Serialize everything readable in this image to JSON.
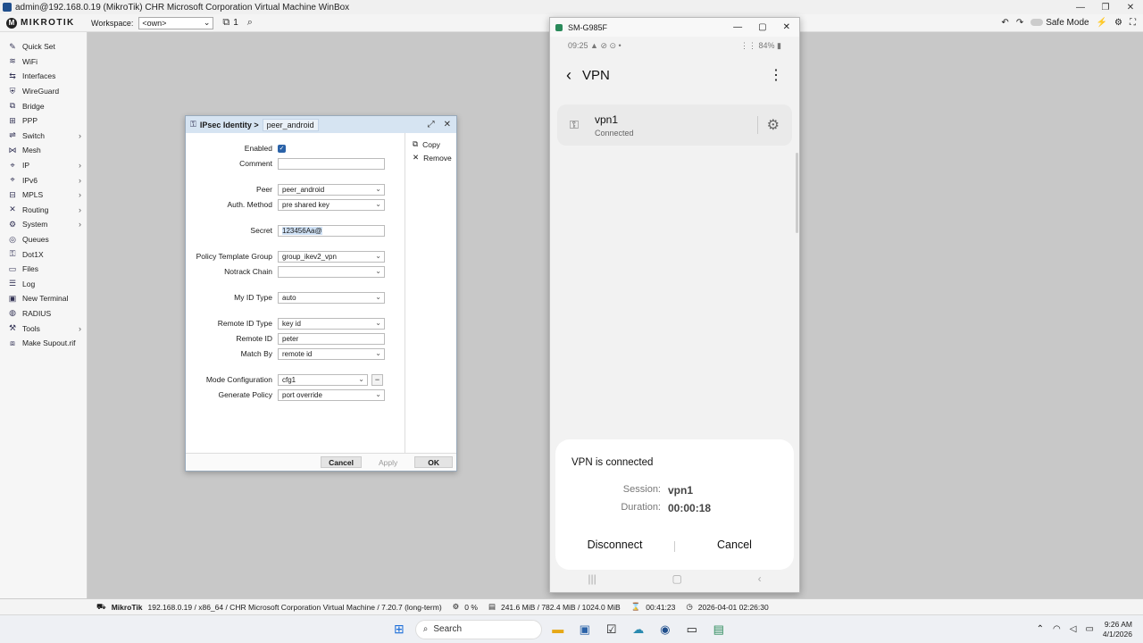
{
  "window": {
    "title": "admin@192.168.0.19 (MikroTik) CHR Microsoft Corporation Virtual Machine WinBox",
    "controls": [
      "—",
      "❐",
      "✕"
    ]
  },
  "toolbar": {
    "logo_text": "MIKROTIK",
    "workspace_label": "Workspace:",
    "workspace_value": "<own>",
    "window_count": "1",
    "safe_mode_label": "Safe Mode"
  },
  "sidebar": {
    "items": [
      {
        "label": "Quick Set",
        "icon": "✎",
        "submenu": false
      },
      {
        "label": "WiFi",
        "icon": "≋",
        "submenu": false
      },
      {
        "label": "Interfaces",
        "icon": "⇆",
        "submenu": false
      },
      {
        "label": "WireGuard",
        "icon": "⛨",
        "submenu": false
      },
      {
        "label": "Bridge",
        "icon": "⧉",
        "submenu": false
      },
      {
        "label": "PPP",
        "icon": "⊞",
        "submenu": false
      },
      {
        "label": "Switch",
        "icon": "⇌",
        "submenu": true
      },
      {
        "label": "Mesh",
        "icon": "⋈",
        "submenu": false
      },
      {
        "label": "IP",
        "icon": "⌖",
        "submenu": true
      },
      {
        "label": "IPv6",
        "icon": "⌖",
        "submenu": true
      },
      {
        "label": "MPLS",
        "icon": "⊟",
        "submenu": true
      },
      {
        "label": "Routing",
        "icon": "✕",
        "submenu": true
      },
      {
        "label": "System",
        "icon": "⚙",
        "submenu": true
      },
      {
        "label": "Queues",
        "icon": "◎",
        "submenu": false
      },
      {
        "label": "Dot1X",
        "icon": "⚿",
        "submenu": false
      },
      {
        "label": "Files",
        "icon": "▭",
        "submenu": false
      },
      {
        "label": "Log",
        "icon": "☰",
        "submenu": false
      },
      {
        "label": "New Terminal",
        "icon": "▣",
        "submenu": false
      },
      {
        "label": "RADIUS",
        "icon": "◍",
        "submenu": false
      },
      {
        "label": "Tools",
        "icon": "⚒",
        "submenu": true
      },
      {
        "label": "Make Supout.rif",
        "icon": "⧈",
        "submenu": false
      }
    ]
  },
  "dialog": {
    "breadcrumb": "IPsec Identity >",
    "object_name": "peer_android",
    "side_actions": [
      {
        "label": "Copy",
        "icon": "⧉"
      },
      {
        "label": "Remove",
        "icon": "✕"
      }
    ],
    "fields": {
      "enabled_label": "Enabled",
      "comment_label": "Comment",
      "comment_value": "",
      "peer_label": "Peer",
      "peer_value": "peer_android",
      "auth_label": "Auth. Method",
      "auth_value": "pre shared key",
      "secret_label": "Secret",
      "secret_value": "123456Aa@",
      "ptg_label": "Policy Template Group",
      "ptg_value": "group_ikev2_vpn",
      "notrack_label": "Notrack Chain",
      "notrack_value": "",
      "myid_label": "My ID Type",
      "myid_value": "auto",
      "remoteidtype_label": "Remote ID Type",
      "remoteidtype_value": "key id",
      "remoteid_label": "Remote ID",
      "remoteid_value": "peter",
      "matchby_label": "Match By",
      "matchby_value": "remote id",
      "modeconf_label": "Mode Configuration",
      "modeconf_value": "cfg1",
      "genpolicy_label": "Generate Policy",
      "genpolicy_value": "port override"
    },
    "buttons": {
      "cancel": "Cancel",
      "apply": "Apply",
      "ok": "OK"
    }
  },
  "phone": {
    "window_title": "SM-G985F",
    "status_time": "09:25",
    "status_icons": "▲ ⊘ ⊙ •",
    "status_right": "84%",
    "screen_title": "VPN",
    "vpn_name": "vpn1",
    "vpn_status": "Connected",
    "sheet": {
      "title": "VPN is connected",
      "session_label": "Session:",
      "session_value": "vpn1",
      "duration_label": "Duration:",
      "duration_value": "00:00:18",
      "disconnect": "Disconnect",
      "cancel": "Cancel"
    }
  },
  "statusbar": {
    "brand": "MikroTik",
    "system": "192.168.0.19 / x86_64 / CHR Microsoft Corporation Virtual Machine / 7.20.7 (long-term)",
    "cpu": "0 %",
    "memory": "241.6 MiB / 782.4 MiB / 1024.0 MiB",
    "uptime": "00:41:23",
    "datetime": "2026-04-01 02:26:30"
  },
  "taskbar": {
    "search_placeholder": "Search",
    "time": "9:26 AM",
    "date": "4/1/2026"
  }
}
